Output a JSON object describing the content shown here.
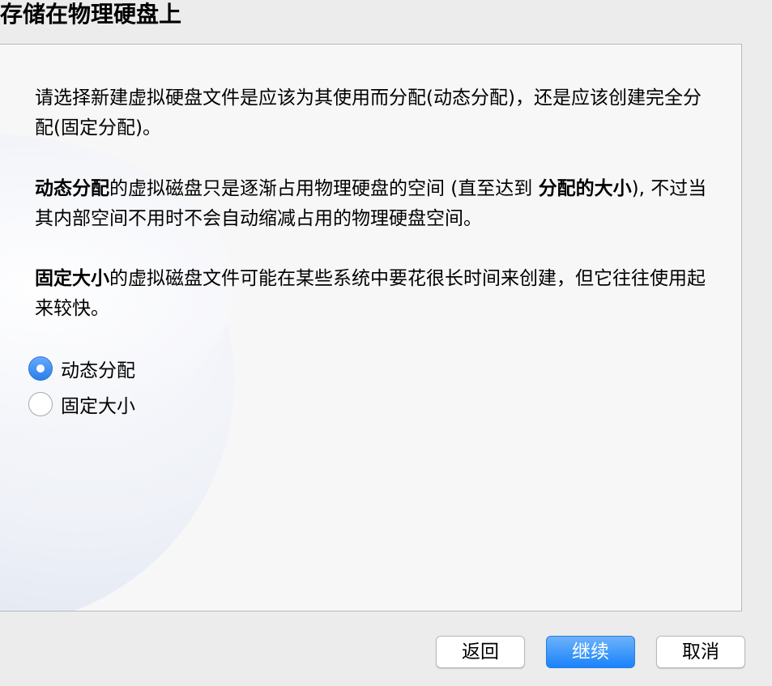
{
  "header": {
    "title": "存储在物理硬盘上"
  },
  "description": {
    "paragraph1": "请选择新建虚拟硬盘文件是应该为其使用而分配(动态分配)，还是应该创建完全分配(固定分配)。",
    "paragraph2_bold_start": "动态分配",
    "paragraph2_mid": "的虚拟磁盘只是逐渐占用物理硬盘的空间 (直至达到 ",
    "paragraph2_bold_mid": "分配的大小",
    "paragraph2_end": "), 不过当其内部空间不用时不会自动缩减占用的物理硬盘空间。",
    "paragraph3_bold_start": "固定大小",
    "paragraph3_end": "的虚拟磁盘文件可能在某些系统中要花很长时间来创建，但它往往使用起来较快。"
  },
  "options": {
    "dynamic_label": "动态分配",
    "fixed_label": "固定大小",
    "selected": "dynamic"
  },
  "buttons": {
    "back_label": "返回",
    "continue_label": "继续",
    "cancel_label": "取消"
  },
  "colors": {
    "accent": "#1a82fb",
    "panel_bg": "#f7f7f7",
    "window_bg": "#ececec"
  }
}
